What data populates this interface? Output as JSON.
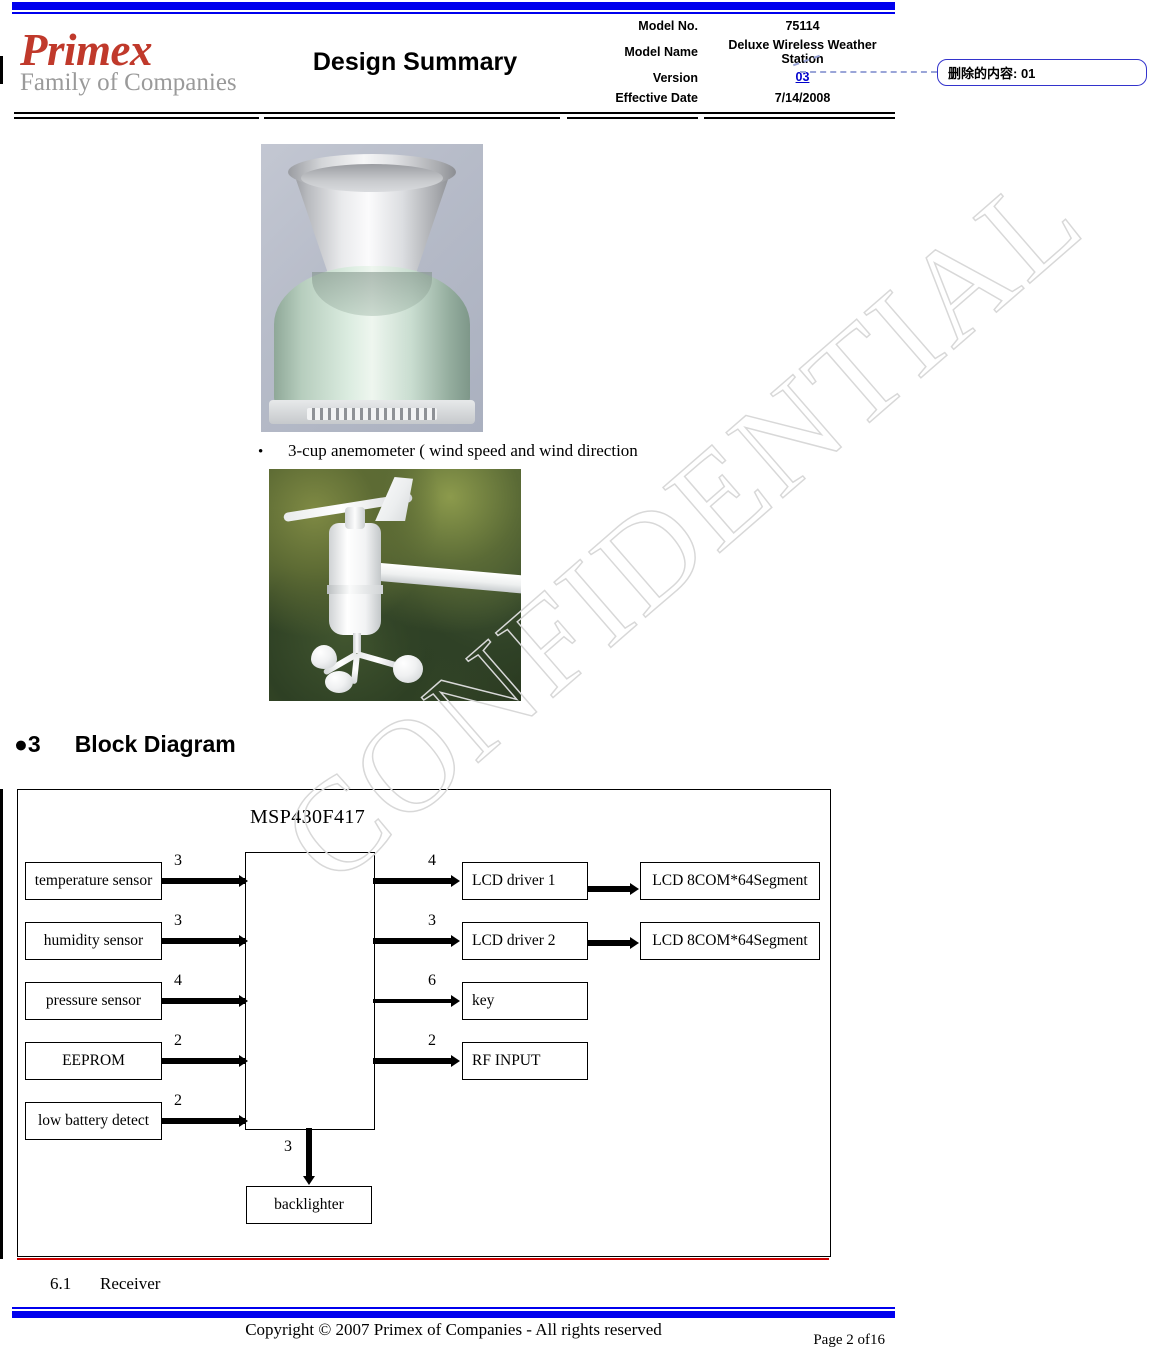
{
  "document": {
    "logo_primary": "Primex",
    "logo_secondary": "Family of Companies",
    "title": "Design Summary"
  },
  "header": {
    "rows": [
      {
        "label": "Model  No.",
        "value": "75114"
      },
      {
        "label": "Model  Name",
        "value": "Deluxe Wireless Weather Station"
      },
      {
        "label": "Version",
        "value": "03"
      },
      {
        "label": "Effective Date",
        "value": "7/14/2008"
      }
    ]
  },
  "comment_balloon": {
    "text": "删除的内容: 01",
    "border_color": "#3333cc"
  },
  "watermark": {
    "text": "CONFIDENTIAL"
  },
  "figures": {
    "rain_gauge": {
      "caption": ""
    },
    "anemometer_bullet": "3-cup anemometer ( wind speed and wind direction"
  },
  "section": {
    "marker": "●3",
    "title": "Block Diagram"
  },
  "block_diagram": {
    "mcu": "MSP430F417",
    "left_blocks": [
      {
        "label": "temperature sensor",
        "bus": "3"
      },
      {
        "label": "humidity sensor",
        "bus": "3"
      },
      {
        "label": "pressure sensor",
        "bus": "4"
      },
      {
        "label": "EEPROM",
        "bus": "2"
      },
      {
        "label": "low battery detect",
        "bus": "2"
      }
    ],
    "right_blocks": [
      {
        "label": "LCD driver 1",
        "bus": "4",
        "target": "LCD 8COM*64Segment"
      },
      {
        "label": "LCD driver 2",
        "bus": "3",
        "target": "LCD 8COM*64Segment"
      },
      {
        "label": "key",
        "bus": "6",
        "target": ""
      },
      {
        "label": "RF INPUT",
        "bus": "2",
        "target": ""
      }
    ],
    "bottom_block": {
      "label": "backlighter",
      "bus": "3"
    }
  },
  "subsection": {
    "number": "6.1",
    "title": "Receiver"
  },
  "footer": {
    "copyright": "Copyright © 2007 Primex of Companies - All rights reserved",
    "page": "Page 2 of16",
    "accent_color": "#0000ee"
  }
}
